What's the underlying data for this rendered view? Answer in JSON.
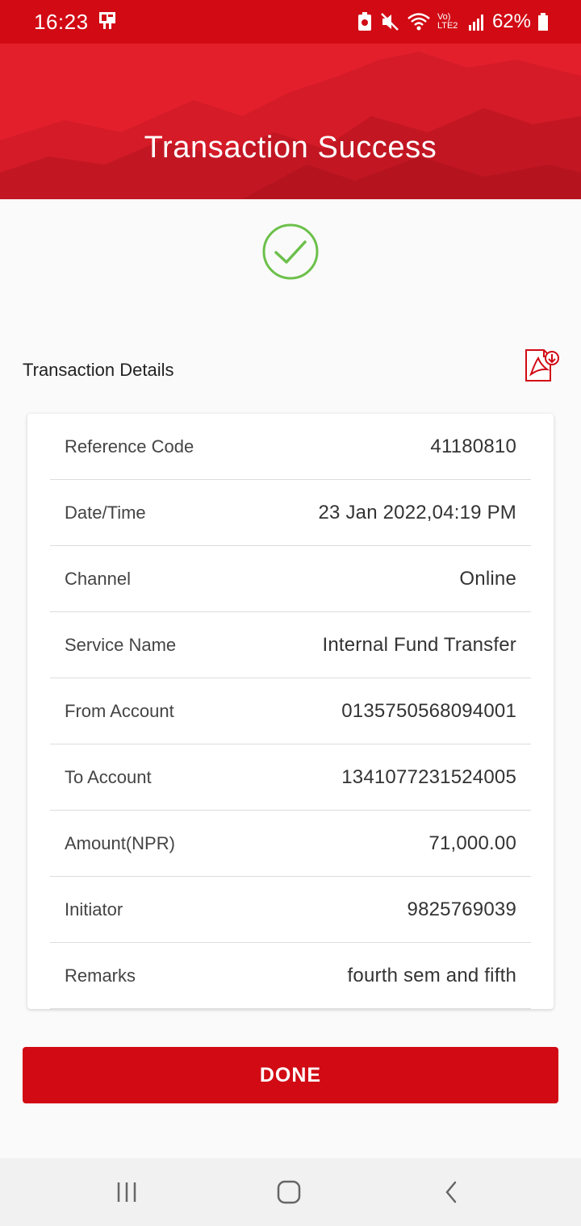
{
  "status_bar": {
    "time": "16:23",
    "battery": "62%",
    "network_label": "Vo) LTE2"
  },
  "header": {
    "title": "Transaction Success"
  },
  "section": {
    "title": "Transaction Details",
    "pdf_icon": "pdf-download-icon"
  },
  "details": [
    {
      "label": "Reference Code",
      "value": "41180810"
    },
    {
      "label": "Date/Time",
      "value": "23 Jan 2022,04:19 PM"
    },
    {
      "label": "Channel",
      "value": "Online"
    },
    {
      "label": "Service Name",
      "value": "Internal Fund Transfer"
    },
    {
      "label": "From Account",
      "value": "0135750568094001"
    },
    {
      "label": "To Account",
      "value": "1341077231524005"
    },
    {
      "label": "Amount(NPR)",
      "value": "71,000.00"
    },
    {
      "label": "Initiator",
      "value": "9825769039"
    },
    {
      "label": "Remarks",
      "value": "fourth sem and fifth"
    }
  ],
  "done_button": {
    "label": "DONE"
  },
  "colors": {
    "brand_red": "#d10a14",
    "header_red": "#e41f2c",
    "success_green": "#6cc04a"
  },
  "nav": {
    "recents_icon": "recents-icon",
    "home_icon": "home-icon",
    "back_icon": "back-icon"
  }
}
